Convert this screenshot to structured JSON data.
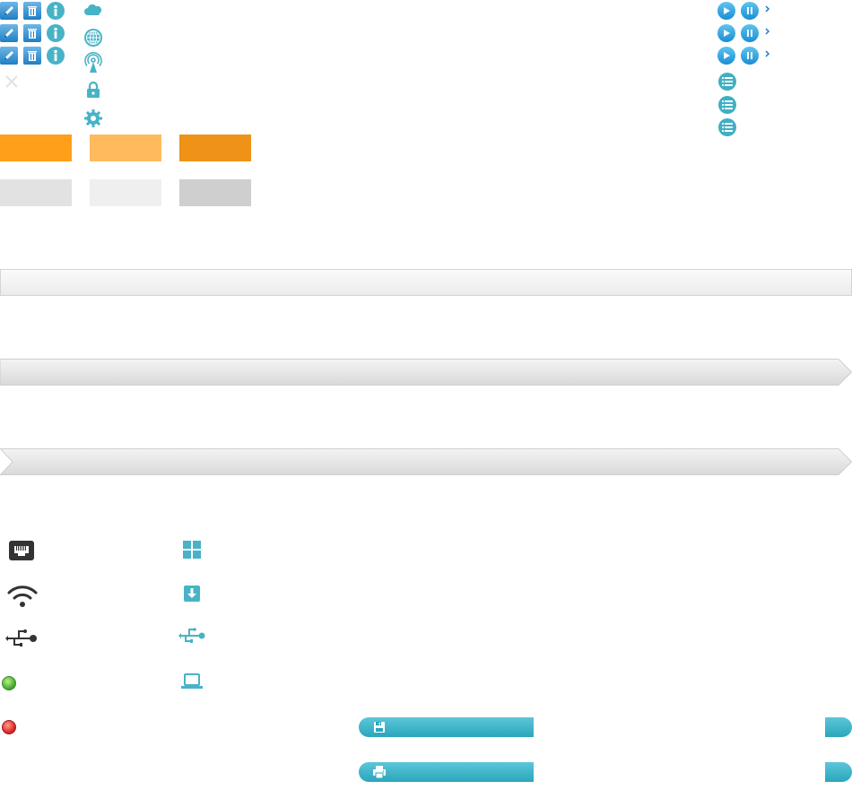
{
  "window": {
    "width": 950,
    "height": 900
  },
  "toolbar_rows": [
    {
      "edit_icon": "pencil-icon",
      "delete_icon": "trash-icon",
      "info_icon": "info-icon"
    },
    {
      "edit_icon": "pencil-icon",
      "delete_icon": "trash-icon",
      "info_icon": "info-icon"
    },
    {
      "edit_icon": "pencil-icon",
      "delete_icon": "trash-icon",
      "info_icon": "info-icon"
    }
  ],
  "close_icon": "close-icon",
  "left_icons": [
    "cloud-icon",
    "globe-icon",
    "antenna-icon",
    "lock-icon",
    "gear-icon"
  ],
  "swatches_orange": [
    "#ff9f1a",
    "#ffba5c",
    "#ef9218"
  ],
  "swatches_gray": [
    "#e2e2e2",
    "#efefef",
    "#cfcfcf"
  ],
  "bars": [
    "plain-bar",
    "arrow-bar",
    "chevron-bar"
  ],
  "media_rows": [
    {
      "play": "play-icon",
      "pause": "pause-icon",
      "arrow": "chevron-right-icon"
    },
    {
      "play": "play-icon",
      "pause": "pause-icon",
      "arrow": "chevron-right-icon"
    },
    {
      "play": "play-icon",
      "pause": "pause-icon",
      "arrow": "chevron-right-icon"
    }
  ],
  "list_icons": [
    "list-icon",
    "list-icon",
    "list-icon"
  ],
  "device_icons_left": [
    "ethernet-icon",
    "wifi-icon",
    "usb-icon",
    "status-green-icon",
    "status-red-icon"
  ],
  "device_icons_right": [
    "grid-icon",
    "download-icon",
    "usb-teal-icon",
    "laptop-icon"
  ],
  "action_buttons": [
    "save-icon",
    "print-icon"
  ],
  "colors": {
    "accent": "#48b3c6",
    "blue": "#1f7fc6",
    "orange": "#ff9f1a"
  }
}
